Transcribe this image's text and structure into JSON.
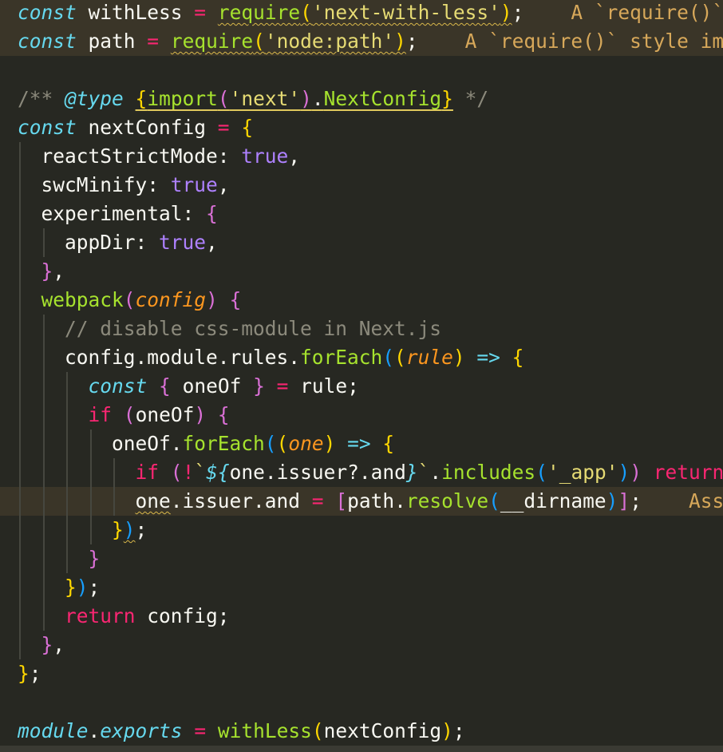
{
  "colors": {
    "background": "#272822",
    "keyword": "#66D9EF",
    "operator": "#F92672",
    "string": "#E6DB74",
    "function": "#A6E22E",
    "literal": "#AE81FF",
    "parameter": "#FD971F",
    "comment": "#8c8a7c",
    "diagnostic": "#D7A85A"
  },
  "lines": [
    {
      "highlight": true,
      "guides": [],
      "tokens": [
        {
          "c": "kw-italic",
          "t": "const"
        },
        {
          "c": "plain",
          "t": " withLess "
        },
        {
          "c": "op",
          "t": "="
        },
        {
          "c": "plain",
          "t": " "
        },
        {
          "c": "fn squig",
          "t": "require"
        },
        {
          "c": "br1 squig",
          "t": "("
        },
        {
          "c": "str squig",
          "t": "'next-with-less'"
        },
        {
          "c": "br1 squig",
          "t": ")"
        },
        {
          "c": "plain",
          "t": ";"
        },
        {
          "c": "diag",
          "t": "    A `require()` style import is forbidden."
        }
      ]
    },
    {
      "highlight": true,
      "guides": [],
      "tokens": [
        {
          "c": "kw-italic",
          "t": "const"
        },
        {
          "c": "plain",
          "t": " path "
        },
        {
          "c": "op",
          "t": "="
        },
        {
          "c": "plain",
          "t": " "
        },
        {
          "c": "fn squig",
          "t": "require"
        },
        {
          "c": "br1 squig",
          "t": "("
        },
        {
          "c": "str squig",
          "t": "'node:path'"
        },
        {
          "c": "br1 squig",
          "t": ")"
        },
        {
          "c": "plain",
          "t": ";"
        },
        {
          "c": "diag",
          "t": "    A `require()` style import is forbidden."
        }
      ]
    },
    {
      "highlight": false,
      "guides": [],
      "tokens": []
    },
    {
      "highlight": false,
      "guides": [],
      "tokens": [
        {
          "c": "comment",
          "t": "/** "
        },
        {
          "c": "kw-italic",
          "t": "@type"
        },
        {
          "c": "plain",
          "t": " "
        },
        {
          "c": "br1 ul",
          "t": "{"
        },
        {
          "c": "fn ul",
          "t": "import"
        },
        {
          "c": "br2 ul",
          "t": "("
        },
        {
          "c": "str ul",
          "t": "'next'"
        },
        {
          "c": "br2 ul",
          "t": ")"
        },
        {
          "c": "plain ul",
          "t": "."
        },
        {
          "c": "fn ul",
          "t": "NextConfig"
        },
        {
          "c": "br1 ul",
          "t": "}"
        },
        {
          "c": "comment",
          "t": " */"
        }
      ]
    },
    {
      "highlight": false,
      "guides": [],
      "tokens": [
        {
          "c": "kw-italic",
          "t": "const"
        },
        {
          "c": "plain",
          "t": " nextConfig "
        },
        {
          "c": "op",
          "t": "="
        },
        {
          "c": "plain",
          "t": " "
        },
        {
          "c": "br1",
          "t": "{"
        }
      ]
    },
    {
      "highlight": false,
      "guides": [
        0
      ],
      "tokens": [
        {
          "c": "plain",
          "t": "  reactStrictMode: "
        },
        {
          "c": "num",
          "t": "true"
        },
        {
          "c": "plain",
          "t": ","
        }
      ]
    },
    {
      "highlight": false,
      "guides": [
        0
      ],
      "tokens": [
        {
          "c": "plain",
          "t": "  swcMinify: "
        },
        {
          "c": "num",
          "t": "true"
        },
        {
          "c": "plain",
          "t": ","
        }
      ]
    },
    {
      "highlight": false,
      "guides": [
        0
      ],
      "tokens": [
        {
          "c": "plain",
          "t": "  experimental: "
        },
        {
          "c": "br2",
          "t": "{"
        }
      ]
    },
    {
      "highlight": false,
      "guides": [
        0,
        1
      ],
      "tokens": [
        {
          "c": "plain",
          "t": "    appDir: "
        },
        {
          "c": "num",
          "t": "true"
        },
        {
          "c": "plain",
          "t": ","
        }
      ]
    },
    {
      "highlight": false,
      "guides": [
        0
      ],
      "tokens": [
        {
          "c": "plain",
          "t": "  "
        },
        {
          "c": "br2",
          "t": "}"
        },
        {
          "c": "plain",
          "t": ","
        }
      ]
    },
    {
      "highlight": false,
      "guides": [
        0
      ],
      "tokens": [
        {
          "c": "plain",
          "t": "  "
        },
        {
          "c": "fn",
          "t": "webpack"
        },
        {
          "c": "br2",
          "t": "("
        },
        {
          "c": "param",
          "t": "config"
        },
        {
          "c": "br2",
          "t": ")"
        },
        {
          "c": "plain",
          "t": " "
        },
        {
          "c": "br2",
          "t": "{"
        }
      ]
    },
    {
      "highlight": false,
      "guides": [
        0,
        1
      ],
      "tokens": [
        {
          "c": "plain",
          "t": "    "
        },
        {
          "c": "comment",
          "t": "// disable css-module in Next.js"
        }
      ]
    },
    {
      "highlight": false,
      "guides": [
        0,
        1
      ],
      "tokens": [
        {
          "c": "plain",
          "t": "    config.module.rules."
        },
        {
          "c": "fn",
          "t": "forEach"
        },
        {
          "c": "br3",
          "t": "("
        },
        {
          "c": "br1",
          "t": "("
        },
        {
          "c": "param",
          "t": "rule"
        },
        {
          "c": "br1",
          "t": ")"
        },
        {
          "c": "plain",
          "t": " "
        },
        {
          "c": "kw-italic",
          "t": "=>"
        },
        {
          "c": "plain",
          "t": " "
        },
        {
          "c": "br1",
          "t": "{"
        }
      ]
    },
    {
      "highlight": false,
      "guides": [
        0,
        1,
        2
      ],
      "tokens": [
        {
          "c": "plain",
          "t": "      "
        },
        {
          "c": "kw-italic",
          "t": "const"
        },
        {
          "c": "plain",
          "t": " "
        },
        {
          "c": "br2",
          "t": "{"
        },
        {
          "c": "plain",
          "t": " oneOf "
        },
        {
          "c": "br2",
          "t": "}"
        },
        {
          "c": "plain",
          "t": " "
        },
        {
          "c": "op",
          "t": "="
        },
        {
          "c": "plain",
          "t": " rule;"
        }
      ]
    },
    {
      "highlight": false,
      "guides": [
        0,
        1,
        2
      ],
      "tokens": [
        {
          "c": "plain",
          "t": "      "
        },
        {
          "c": "kw",
          "t": "if"
        },
        {
          "c": "plain",
          "t": " "
        },
        {
          "c": "br2",
          "t": "("
        },
        {
          "c": "plain",
          "t": "oneOf"
        },
        {
          "c": "br2",
          "t": ")"
        },
        {
          "c": "plain",
          "t": " "
        },
        {
          "c": "br2",
          "t": "{"
        }
      ]
    },
    {
      "highlight": false,
      "guides": [
        0,
        1,
        2,
        3
      ],
      "tokens": [
        {
          "c": "plain",
          "t": "        oneOf."
        },
        {
          "c": "fn",
          "t": "forEach"
        },
        {
          "c": "br3",
          "t": "("
        },
        {
          "c": "br1",
          "t": "("
        },
        {
          "c": "param",
          "t": "one"
        },
        {
          "c": "br1",
          "t": ")"
        },
        {
          "c": "plain",
          "t": " "
        },
        {
          "c": "kw-italic",
          "t": "=>"
        },
        {
          "c": "plain",
          "t": " "
        },
        {
          "c": "br1",
          "t": "{"
        }
      ]
    },
    {
      "highlight": false,
      "guides": [
        0,
        1,
        2,
        3,
        4
      ],
      "tokens": [
        {
          "c": "plain",
          "t": "          "
        },
        {
          "c": "kw",
          "t": "if"
        },
        {
          "c": "plain",
          "t": " "
        },
        {
          "c": "br2",
          "t": "("
        },
        {
          "c": "op",
          "t": "!"
        },
        {
          "c": "str",
          "t": "`"
        },
        {
          "c": "kw-italic",
          "t": "${"
        },
        {
          "c": "plain",
          "t": "one.issuer?.and"
        },
        {
          "c": "kw-italic",
          "t": "}"
        },
        {
          "c": "str",
          "t": "`"
        },
        {
          "c": "plain",
          "t": "."
        },
        {
          "c": "fn",
          "t": "includes"
        },
        {
          "c": "br3",
          "t": "("
        },
        {
          "c": "str",
          "t": "'_app'"
        },
        {
          "c": "br3",
          "t": ")"
        },
        {
          "c": "br2",
          "t": ")"
        },
        {
          "c": "plain",
          "t": " "
        },
        {
          "c": "kw",
          "t": "return"
        },
        {
          "c": "plain",
          "t": ";"
        }
      ]
    },
    {
      "highlight": true,
      "guides": [
        0,
        1,
        2,
        3,
        4
      ],
      "tokens": [
        {
          "c": "plain",
          "t": "          "
        },
        {
          "c": "plain squig",
          "t": "one"
        },
        {
          "c": "plain",
          "t": ".issuer.and "
        },
        {
          "c": "op",
          "t": "="
        },
        {
          "c": "plain",
          "t": " "
        },
        {
          "c": "br2",
          "t": "["
        },
        {
          "c": "plain",
          "t": "path."
        },
        {
          "c": "fn",
          "t": "resolve"
        },
        {
          "c": "br3",
          "t": "("
        },
        {
          "c": "plain",
          "t": "__dirname"
        },
        {
          "c": "br3",
          "t": ")"
        },
        {
          "c": "br2",
          "t": "]"
        },
        {
          "c": "plain",
          "t": ";"
        },
        {
          "c": "diag",
          "t": "    Assignment to property of function parameter 'one'."
        }
      ]
    },
    {
      "highlight": false,
      "guides": [
        0,
        1,
        2,
        3
      ],
      "tokens": [
        {
          "c": "plain",
          "t": "        "
        },
        {
          "c": "br1",
          "t": "}"
        },
        {
          "c": "br3 squig",
          "t": ")"
        },
        {
          "c": "plain",
          "t": ";"
        }
      ]
    },
    {
      "highlight": false,
      "guides": [
        0,
        1,
        2
      ],
      "tokens": [
        {
          "c": "plain",
          "t": "      "
        },
        {
          "c": "br2",
          "t": "}"
        }
      ]
    },
    {
      "highlight": false,
      "guides": [
        0,
        1
      ],
      "tokens": [
        {
          "c": "plain",
          "t": "    "
        },
        {
          "c": "br1",
          "t": "}"
        },
        {
          "c": "br3",
          "t": ")"
        },
        {
          "c": "plain",
          "t": ";"
        }
      ]
    },
    {
      "highlight": false,
      "guides": [
        0,
        1
      ],
      "tokens": [
        {
          "c": "plain",
          "t": "    "
        },
        {
          "c": "kw",
          "t": "return"
        },
        {
          "c": "plain",
          "t": " config;"
        }
      ]
    },
    {
      "highlight": false,
      "guides": [
        0
      ],
      "tokens": [
        {
          "c": "plain",
          "t": "  "
        },
        {
          "c": "br2",
          "t": "}"
        },
        {
          "c": "plain",
          "t": ","
        }
      ]
    },
    {
      "highlight": false,
      "guides": [],
      "tokens": [
        {
          "c": "br1",
          "t": "}"
        },
        {
          "c": "plain",
          "t": ";"
        }
      ]
    },
    {
      "highlight": false,
      "guides": [],
      "tokens": []
    },
    {
      "highlight": false,
      "guides": [],
      "tokens": [
        {
          "c": "kw-italic",
          "t": "module"
        },
        {
          "c": "plain",
          "t": "."
        },
        {
          "c": "kw-italic",
          "t": "exports"
        },
        {
          "c": "plain",
          "t": " "
        },
        {
          "c": "op",
          "t": "="
        },
        {
          "c": "plain",
          "t": " "
        },
        {
          "c": "fn",
          "t": "withLess"
        },
        {
          "c": "br1",
          "t": "("
        },
        {
          "c": "plain",
          "t": "nextConfig"
        },
        {
          "c": "br1",
          "t": ")"
        },
        {
          "c": "plain",
          "t": ";"
        }
      ]
    }
  ]
}
